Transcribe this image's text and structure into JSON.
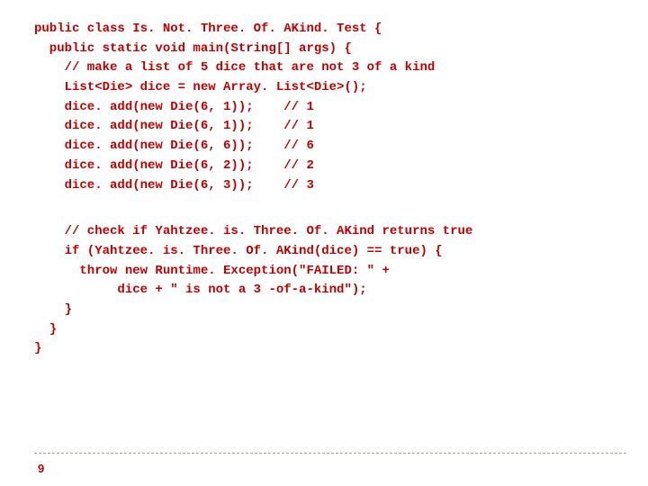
{
  "code": {
    "l01": "public class Is. Not. Three. Of. AKind. Test {",
    "l02": "  public static void main(String[] args) {",
    "l03": "    // make a list of 5 dice that are not 3 of a kind",
    "l04": "    List<Die> dice = new Array. List<Die>();",
    "l05": "    dice. add(new Die(6, 1));    // 1",
    "l06": "    dice. add(new Die(6, 1));    // 1",
    "l07": "    dice. add(new Die(6, 6));    // 6",
    "l08": "    dice. add(new Die(6, 2));    // 2",
    "l09": "    dice. add(new Die(6, 3));    // 3",
    "l10": "    // check if Yahtzee. is. Three. Of. AKind returns true",
    "l11": "    if (Yahtzee. is. Three. Of. AKind(dice) == true) {",
    "l12": "      throw new Runtime. Exception(\"FAILED: \" +",
    "l13": "           dice + \" is not a 3 -of-a-kind\");",
    "l14": "    }",
    "l15": "  }",
    "l16": "}"
  },
  "page_number": "9"
}
